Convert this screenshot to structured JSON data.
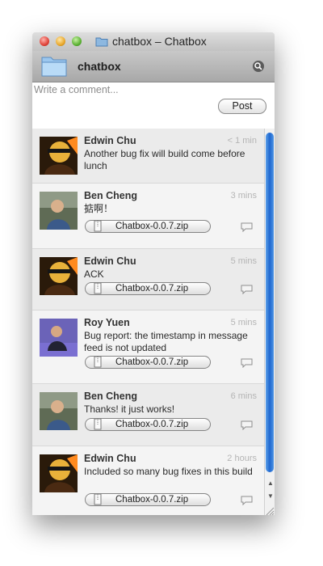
{
  "window": {
    "title": "chatbox – Chatbox"
  },
  "header": {
    "project_name": "chatbox",
    "search_icon": "search-icon"
  },
  "compose": {
    "placeholder": "Write a comment...",
    "post_label": "Post"
  },
  "feed": {
    "messages": [
      {
        "author": "Edwin Chu",
        "time": "< 1 min",
        "text": "Another bug fix will build come before lunch",
        "attachment": ""
      },
      {
        "author": "Ben Cheng",
        "time": "3 mins",
        "text": "掂啊！",
        "attachment": "Chatbox-0.0.7.zip"
      },
      {
        "author": "Edwin Chu",
        "time": "5 mins",
        "text": "ACK",
        "attachment": "Chatbox-0.0.7.zip"
      },
      {
        "author": "Roy Yuen",
        "time": "5 mins",
        "text": "Bug report: the timestamp in message feed is not updated",
        "attachment": "Chatbox-0.0.7.zip"
      },
      {
        "author": "Ben Cheng",
        "time": "6 mins",
        "text": "Thanks! it just works!",
        "attachment": "Chatbox-0.0.7.zip"
      },
      {
        "author": "Edwin Chu",
        "time": "2 hours",
        "text": "Included so many bug fixes in this build",
        "attachment": "Chatbox-0.0.7.zip"
      }
    ]
  },
  "colors": {
    "scroll_thumb": "#2a74d6",
    "timestamp": "#b5b5b5"
  }
}
